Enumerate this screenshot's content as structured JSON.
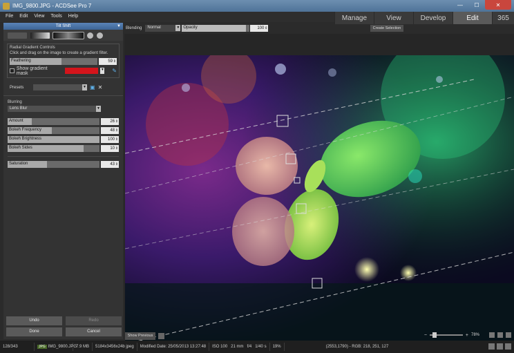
{
  "window": {
    "title": "IMG_9800.JPG - ACDSee Pro 7",
    "minimize": "—",
    "maximize": "☐",
    "close": "✕"
  },
  "menu": [
    "File",
    "Edit",
    "View",
    "Tools",
    "Help"
  ],
  "modes": [
    {
      "label": "Manage",
      "active": false
    },
    {
      "label": "View",
      "active": false
    },
    {
      "label": "Develop",
      "active": false
    },
    {
      "label": "Edit",
      "active": true
    },
    {
      "label": "365",
      "active": false
    }
  ],
  "panel": {
    "title": "Tilt Shift",
    "radial_group": {
      "title": "Radial Gradient Controls",
      "hint": "Click and drag on the image to create a gradient filter.",
      "feathering": {
        "label": "Feathering",
        "value": "59",
        "level": 0.59
      },
      "show_mask_label": "Show gradient mask",
      "mask_color": "#d4141b"
    },
    "presets_label": "Presets",
    "blurring": {
      "title": "Blurring",
      "mode": "Lens Blur",
      "sliders": [
        {
          "label": "Amount",
          "value": "26",
          "level": 0.26
        },
        {
          "label": "Bokeh Frequency",
          "value": "48",
          "level": 0.48
        },
        {
          "label": "Bokeh Brightness",
          "value": "100",
          "level": 1.0
        },
        {
          "label": "Bokeh Sides",
          "value": "10",
          "level": 0.83
        }
      ]
    },
    "saturation": {
      "label": "Saturation",
      "value": "43",
      "level": 0.43
    },
    "buttons": {
      "undo": "Undo",
      "redo": "Redo",
      "done": "Done",
      "cancel": "Cancel"
    }
  },
  "options": {
    "blending_label": "Blending",
    "blend_mode": "Normal",
    "opacity_label": "Opacity",
    "opacity_value": "100",
    "create_selection": "Create Selection"
  },
  "footer": {
    "show_previous": "Show Previous",
    "zoom": "78%"
  },
  "status": {
    "index": "128/343",
    "format": "JPG",
    "filename": "IMG_9800.JPG",
    "size": "7.9 MB",
    "dimensions": "5184x3456x24b jpeg",
    "modified": "Modified Date: 25/05/2013 13:27:48",
    "iso": "ISO 100",
    "focal": "21 mm",
    "aperture": "f/4",
    "shutter": "1/40 s",
    "zoom": "19%",
    "pixel": "(2553,1790) - RGB: 218, 251, 127"
  }
}
